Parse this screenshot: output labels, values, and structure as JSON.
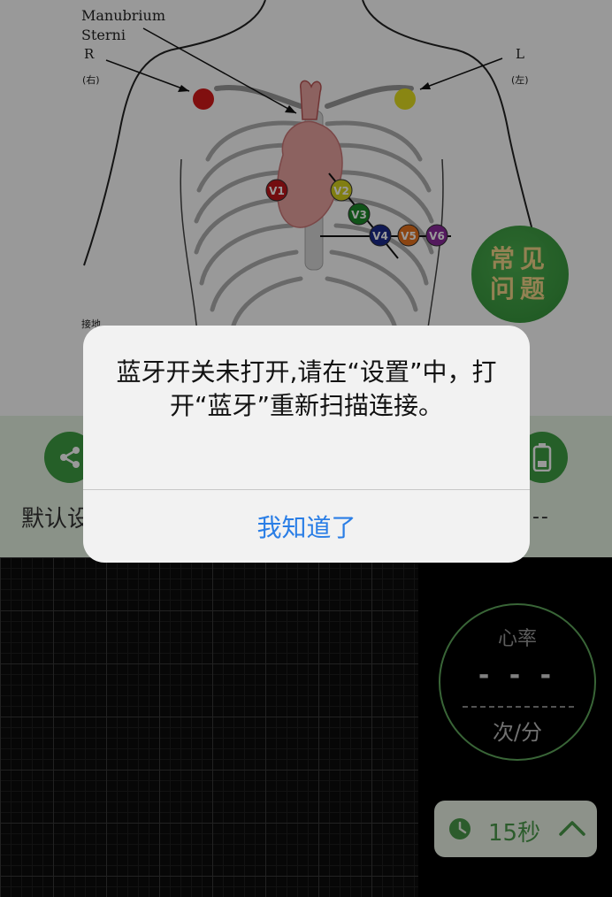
{
  "diagram": {
    "manubrium_label_line1": "Manubrium",
    "manubrium_label_line2": "Sterni",
    "right_label": "R",
    "right_label_cn": "(右)",
    "left_label": "L",
    "left_label_cn": "(左)",
    "misc_label": "接地",
    "electrodes": [
      {
        "label": "V1",
        "color": "#c0171c"
      },
      {
        "label": "V2",
        "color": "#d7d21f"
      },
      {
        "label": "V3",
        "color": "#1d8a2a"
      },
      {
        "label": "V4",
        "color": "#1b2a8c"
      },
      {
        "label": "V5",
        "color": "#e8731f"
      },
      {
        "label": "V6",
        "color": "#8a2a9c"
      }
    ],
    "limb_colors": {
      "right": "#d61a1a",
      "left": "#e4e020"
    }
  },
  "faq": {
    "label": "常见问题"
  },
  "status": {
    "mode_label": "默认设置",
    "battery_value": "---",
    "icons": [
      "share-icon",
      "battery-icon"
    ]
  },
  "heart_rate": {
    "title": "心率",
    "value": "- - -",
    "unit": "次/分"
  },
  "duration": {
    "label": "15秒",
    "icons": [
      "clock-icon",
      "chevron-up-icon"
    ]
  },
  "alert": {
    "message": "蓝牙开关未打开,请在“设置”中，打开“蓝牙”重新扫描连接。",
    "button_label": "我知道了",
    "button_color": "#2a7ee6"
  }
}
